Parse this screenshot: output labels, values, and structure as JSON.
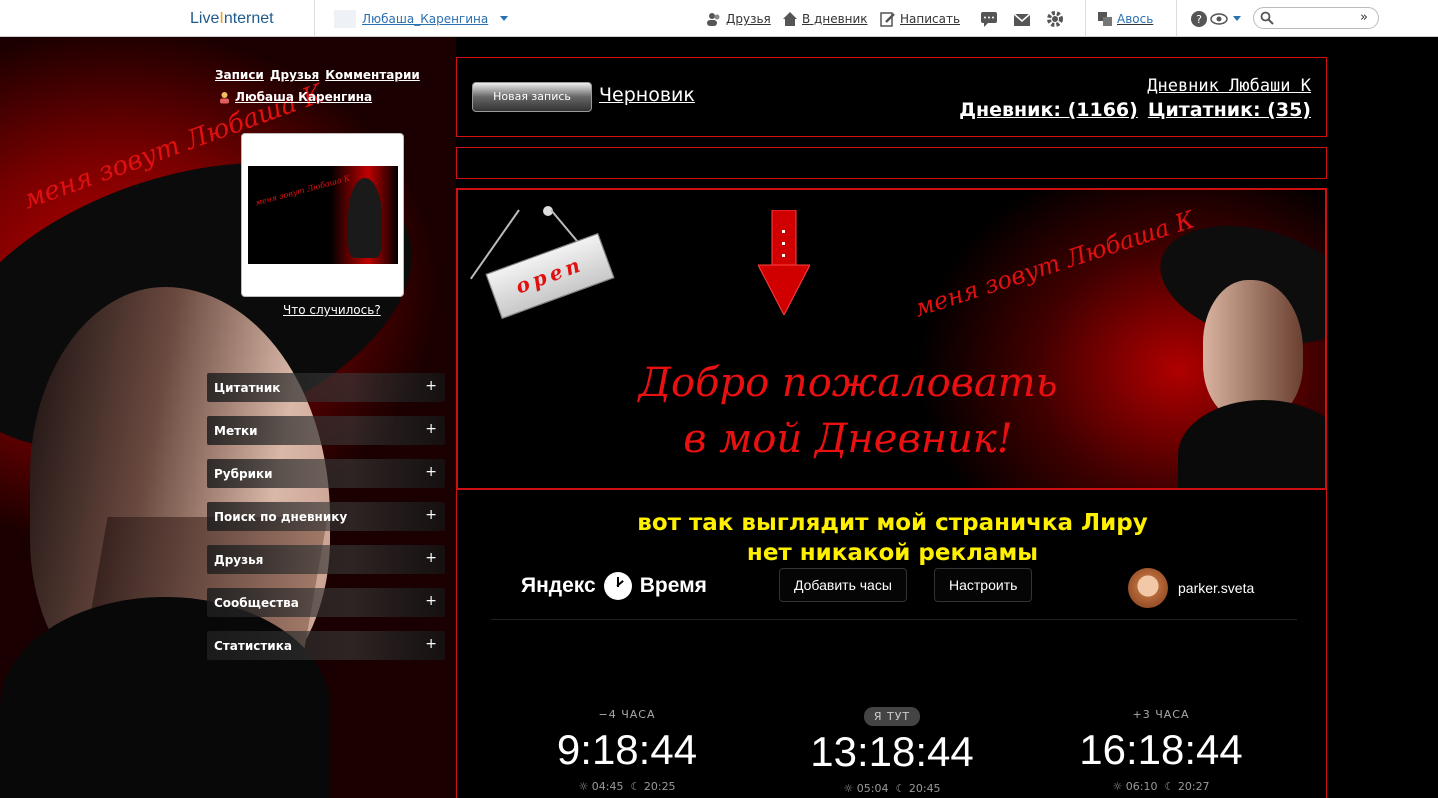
{
  "topbar": {
    "logo_main": "Live",
    "logo_accent": "Internet",
    "user": "Любаша_Каренгина",
    "friends": "Друзья",
    "to_diary": "В дневник",
    "write": "Написать",
    "avos": "Авось",
    "search_go": "»"
  },
  "sidebar": {
    "nav": [
      "Записи",
      "Друзья",
      "Комментарии"
    ],
    "username": "Любаша Каренгина",
    "script_text": "меня зовут Любаша К",
    "avatar_text": "меня зовут Любаша К",
    "what_happened": "Что случилось?",
    "items": [
      {
        "label": "Цитатник",
        "plus": "+"
      },
      {
        "label": "Метки",
        "plus": "+"
      },
      {
        "label": "Рубрики",
        "plus": "+"
      },
      {
        "label": "Поиск по дневнику",
        "plus": "+"
      },
      {
        "label": "Друзья",
        "plus": "+"
      },
      {
        "label": "Сообщества",
        "plus": "+"
      },
      {
        "label": "Статистика",
        "plus": "+"
      }
    ]
  },
  "header": {
    "new_post": "Новая запись",
    "draft": "Черновик",
    "diary_title": "Дневник Любаши К",
    "diary_count": "Дневник: (1166)",
    "quote_count": "Цитатник: (35)"
  },
  "banner": {
    "sign_text": "open",
    "script_text": "меня зовут Любаша К",
    "welcome_line1": "Добро пожаловать",
    "welcome_line2": "в мой Дневник!"
  },
  "content": {
    "line1": "вот так выглядит мой страничка Лиру",
    "line2": "нет никакой рекламы"
  },
  "yandex": {
    "logo_left": "Яндекс",
    "logo_right": "Время",
    "add_clock": "Добавить часы",
    "configure": "Настроить",
    "username": "parker.sveta",
    "clocks": [
      {
        "label": "−4 ЧАСА",
        "time": "9:18:44",
        "sunrise": "04:45",
        "sunset": "20:25"
      },
      {
        "label": "Я ТУТ",
        "time": "13:18:44",
        "sunrise": "05:04",
        "sunset": "20:45"
      },
      {
        "label": "+3 ЧАСА",
        "time": "16:18:44",
        "sunrise": "06:10",
        "sunset": "20:27"
      }
    ]
  }
}
